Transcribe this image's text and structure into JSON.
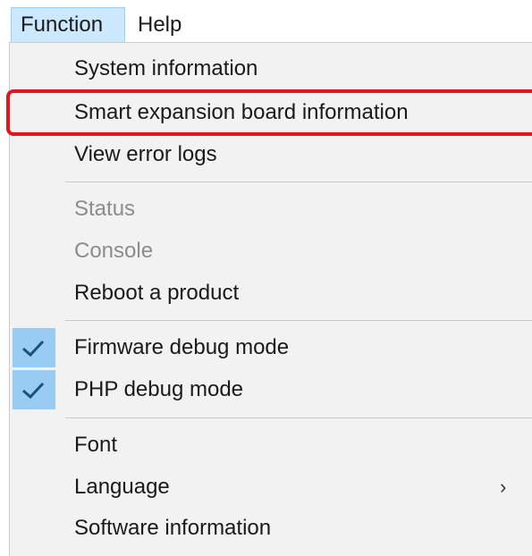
{
  "menubar": {
    "function_label": "Function",
    "help_label": "Help"
  },
  "menu": {
    "items": [
      {
        "label": "System information",
        "enabled": true,
        "checked": false
      },
      {
        "label": "Smart expansion board information",
        "enabled": true,
        "checked": false,
        "highlighted": true
      },
      {
        "label": "View error logs",
        "enabled": true,
        "checked": false
      },
      {
        "label": "Status",
        "enabled": false,
        "checked": false
      },
      {
        "label": "Console",
        "enabled": false,
        "checked": false
      },
      {
        "label": "Reboot a product",
        "enabled": true,
        "checked": false
      },
      {
        "label": "Firmware debug mode",
        "enabled": true,
        "checked": true
      },
      {
        "label": "PHP debug mode",
        "enabled": true,
        "checked": true
      },
      {
        "label": "Font",
        "enabled": true,
        "checked": false
      },
      {
        "label": "Language",
        "enabled": true,
        "checked": false,
        "submenu": true
      },
      {
        "label": "Software information",
        "enabled": true,
        "checked": false
      }
    ],
    "check_icon": "checkmark-icon",
    "submenu_icon": "chevron-right-icon",
    "submenu_glyph": "›"
  },
  "colors": {
    "menubar_active_bg": "#cce8ff",
    "menu_bg": "#f2f2f2",
    "check_bg": "#99ccf3",
    "highlight_border": "#e8141c",
    "disabled_text": "#8c8c8c"
  }
}
